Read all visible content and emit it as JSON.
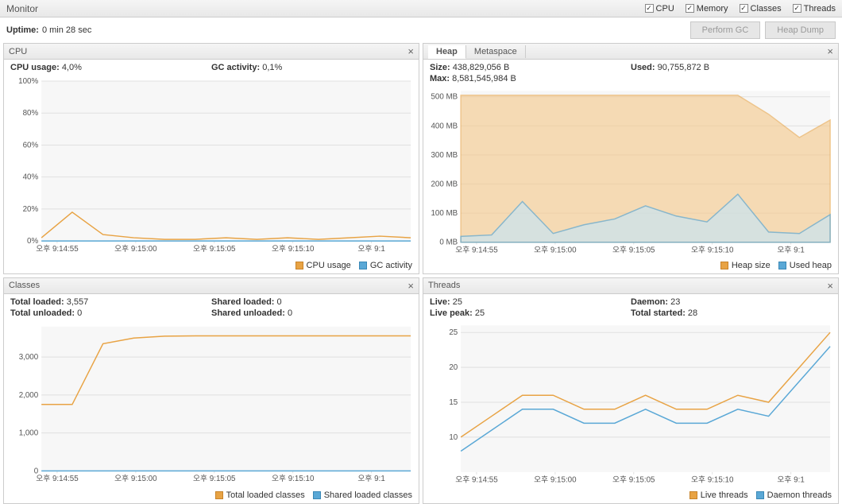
{
  "header": {
    "title": "Monitor",
    "checks": [
      {
        "label": "CPU"
      },
      {
        "label": "Memory"
      },
      {
        "label": "Classes"
      },
      {
        "label": "Threads"
      }
    ]
  },
  "toolbar": {
    "uptime_label": "Uptime:",
    "uptime_value": "0 min 28 sec",
    "btn_gc": "Perform GC",
    "btn_heap": "Heap Dump"
  },
  "panels": {
    "cpu": {
      "title": "CPU",
      "stats": {
        "usage_label": "CPU usage:",
        "usage_value": "4,0%",
        "gc_label": "GC activity:",
        "gc_value": "0,1%"
      },
      "legend_a": "CPU usage",
      "legend_b": "GC activity"
    },
    "heap": {
      "tab_a": "Heap",
      "tab_b": "Metaspace",
      "stats": {
        "size_label": "Size:",
        "size_value": "438,829,056 B",
        "used_label": "Used:",
        "used_value": "90,755,872 B",
        "max_label": "Max:",
        "max_value": "8,581,545,984 B"
      },
      "legend_a": "Heap size",
      "legend_b": "Used heap"
    },
    "classes": {
      "title": "Classes",
      "stats": {
        "loaded_label": "Total loaded:",
        "loaded_value": "3,557",
        "sloaded_label": "Shared loaded:",
        "sloaded_value": "0",
        "unloaded_label": "Total unloaded:",
        "unloaded_value": "0",
        "sunloaded_label": "Shared unloaded:",
        "sunloaded_value": "0"
      },
      "legend_a": "Total loaded classes",
      "legend_b": "Shared loaded classes"
    },
    "threads": {
      "title": "Threads",
      "stats": {
        "live_label": "Live:",
        "live_value": "25",
        "daemon_label": "Daemon:",
        "daemon_value": "23",
        "peak_label": "Live peak:",
        "peak_value": "25",
        "started_label": "Total started:",
        "started_value": "28"
      },
      "legend_a": "Live threads",
      "legend_b": "Daemon threads"
    }
  },
  "x_ticks": [
    "오후 9:14:55",
    "오후 9:15:00",
    "오후 9:15:05",
    "오후 9:15:10",
    "오후 9:1"
  ],
  "chart_data": [
    {
      "id": "cpu",
      "type": "line",
      "title": "CPU",
      "xlabel": "",
      "ylabel": "",
      "ylim": [
        0,
        100
      ],
      "y_ticks": [
        0,
        20,
        40,
        60,
        80,
        100
      ],
      "y_suffix": "%",
      "x": [
        "9:14:53",
        "9:14:54",
        "9:14:55",
        "9:14:56",
        "9:14:58",
        "9:15:00",
        "9:15:02",
        "9:15:04",
        "9:15:06",
        "9:15:08",
        "9:15:10",
        "9:15:12",
        "9:15:14"
      ],
      "series": [
        {
          "name": "CPU usage",
          "values": [
            2,
            18,
            4,
            2,
            1,
            1,
            2,
            1,
            2,
            1,
            2,
            3,
            2
          ]
        },
        {
          "name": "GC activity",
          "values": [
            0,
            0,
            0,
            0,
            0,
            0,
            0,
            0,
            0,
            0,
            0,
            0,
            0
          ]
        }
      ]
    },
    {
      "id": "heap",
      "type": "area",
      "title": "Heap",
      "xlabel": "",
      "ylabel": "",
      "ylim": [
        0,
        520
      ],
      "y_ticks": [
        0,
        100,
        200,
        300,
        400,
        500
      ],
      "y_suffix": " MB",
      "x": [
        "9:14:53",
        "9:14:54",
        "9:14:55",
        "9:14:56",
        "9:14:58",
        "9:15:00",
        "9:15:02",
        "9:15:04",
        "9:15:06",
        "9:15:08",
        "9:15:10",
        "9:15:12",
        "9:15:14"
      ],
      "series": [
        {
          "name": "Heap size",
          "values": [
            505,
            505,
            505,
            505,
            505,
            505,
            505,
            505,
            505,
            505,
            440,
            360,
            420
          ]
        },
        {
          "name": "Used heap",
          "values": [
            20,
            25,
            140,
            30,
            60,
            80,
            125,
            90,
            70,
            165,
            35,
            30,
            95
          ]
        }
      ]
    },
    {
      "id": "classes",
      "type": "line",
      "title": "Classes",
      "xlabel": "",
      "ylabel": "",
      "ylim": [
        0,
        3800
      ],
      "y_ticks": [
        0,
        1000,
        2000,
        3000
      ],
      "y_suffix": "",
      "x": [
        "9:14:53",
        "9:14:54",
        "9:14:55",
        "9:14:56",
        "9:14:58",
        "9:15:00",
        "9:15:02",
        "9:15:04",
        "9:15:06",
        "9:15:08",
        "9:15:10",
        "9:15:12",
        "9:15:14"
      ],
      "series": [
        {
          "name": "Total loaded classes",
          "values": [
            1750,
            1750,
            3350,
            3500,
            3550,
            3557,
            3557,
            3557,
            3557,
            3557,
            3557,
            3557,
            3557
          ]
        },
        {
          "name": "Shared loaded classes",
          "values": [
            0,
            0,
            0,
            0,
            0,
            0,
            0,
            0,
            0,
            0,
            0,
            0,
            0
          ]
        }
      ]
    },
    {
      "id": "threads",
      "type": "line",
      "title": "Threads",
      "xlabel": "",
      "ylabel": "",
      "ylim": [
        5,
        26
      ],
      "y_ticks": [
        10,
        15,
        20,
        25
      ],
      "y_suffix": "",
      "x": [
        "9:14:53",
        "9:14:54",
        "9:14:55",
        "9:14:56",
        "9:14:58",
        "9:15:00",
        "9:15:02",
        "9:15:04",
        "9:15:06",
        "9:15:08",
        "9:15:10",
        "9:15:12",
        "9:15:14"
      ],
      "series": [
        {
          "name": "Live threads",
          "values": [
            10,
            13,
            16,
            16,
            14,
            14,
            16,
            14,
            14,
            16,
            15,
            20,
            25
          ]
        },
        {
          "name": "Daemon threads",
          "values": [
            8,
            11,
            14,
            14,
            12,
            12,
            14,
            12,
            12,
            14,
            13,
            18,
            23
          ]
        }
      ]
    }
  ]
}
